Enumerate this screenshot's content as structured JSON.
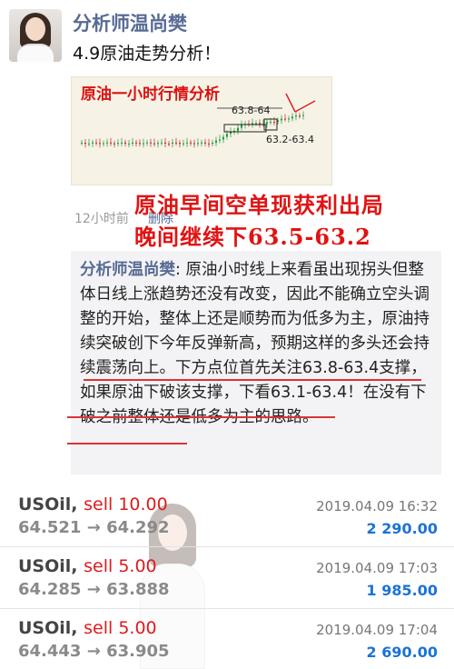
{
  "post": {
    "author": "分析师温尚樊",
    "text": "4.9原油走势分析！",
    "image": {
      "title": "原油一小时行情分析",
      "label_upper": "63.8-64",
      "label_lower": "63.2-63.4"
    },
    "timestamp": "12小时前",
    "delete_label": "删除"
  },
  "overlay": {
    "line1": "原油早间空单现获利出局",
    "line2": "晚间继续下63.5-63.2"
  },
  "comment": {
    "author": "分析师温尚樊",
    "separator": ": ",
    "text": "原油小时线上来看虽出现拐头但整体日线上涨趋势还没有改变，因此不能确立空头调整的开始，整体上还是顺势而为低多为主，原油持续突破创下今年反弹新高，预期这样的多头还会持续震荡向上。下方点位首先关注63.8-63.4支撑，如果原油下破该支撑，下看63.1-63.4！在没有下破之前整体还是低多为主的思路。"
  },
  "trades": [
    {
      "symbol": "USOil,",
      "action": "sell 10.00",
      "prices": "64.521 → 64.292",
      "datetime": "2019.04.09 16:32",
      "profit": "2 290.00"
    },
    {
      "symbol": "USOil,",
      "action": "sell 5.00",
      "prices": "64.285 → 63.888",
      "datetime": "2019.04.09 17:03",
      "profit": "1 985.00"
    },
    {
      "symbol": "USOil,",
      "action": "sell 5.00",
      "prices": "64.443 → 63.905",
      "datetime": "2019.04.09 17:04",
      "profit": "2 690.00"
    }
  ],
  "colors": {
    "link": "#576b95",
    "red": "#e01313",
    "profit": "#1a73d6"
  }
}
